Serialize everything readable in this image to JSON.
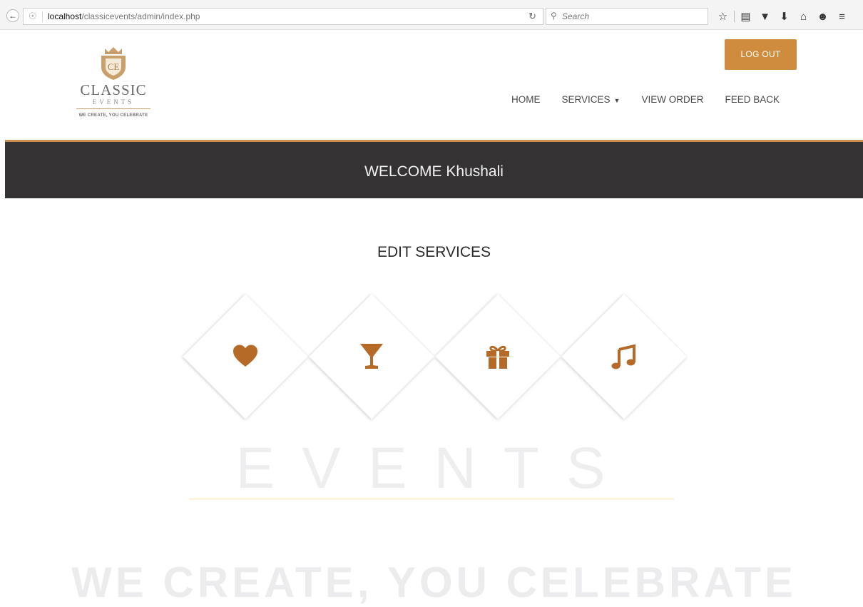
{
  "browser": {
    "url_host": "localhost",
    "url_path": "/classicevents/admin/index.php",
    "search_placeholder": "Search",
    "icons": [
      "back-icon",
      "globe-icon",
      "reload-icon",
      "search-icon",
      "star-icon",
      "reading-list-icon",
      "pocket-icon",
      "download-icon",
      "home-icon",
      "chat-icon",
      "menu-icon"
    ]
  },
  "header": {
    "logo": {
      "title": "CLASSIC",
      "subtitle": "EVENTS",
      "tagline": "WE CREATE, YOU CELEBRATE"
    },
    "logout_label": "LOG OUT",
    "menu": [
      {
        "label": "HOME"
      },
      {
        "label": "SERVICES",
        "has_dropdown": true
      },
      {
        "label": "VIEW ORDER"
      },
      {
        "label": "FEED BACK"
      }
    ]
  },
  "banner": {
    "text": "WELCOME Khushali"
  },
  "main": {
    "section_title": "EDIT SERVICES",
    "services": [
      {
        "icon": "heart-icon"
      },
      {
        "icon": "cocktail-icon"
      },
      {
        "icon": "gift-icon"
      },
      {
        "icon": "music-icon"
      }
    ]
  },
  "watermark": {
    "word": "EVENTS",
    "tagline": "WE CREATE, YOU CELEBRATE"
  },
  "colors": {
    "accent": "#cd8f4f",
    "button": "#d08c3e",
    "banner_bg": "#343233",
    "icon": "#b66a28"
  }
}
